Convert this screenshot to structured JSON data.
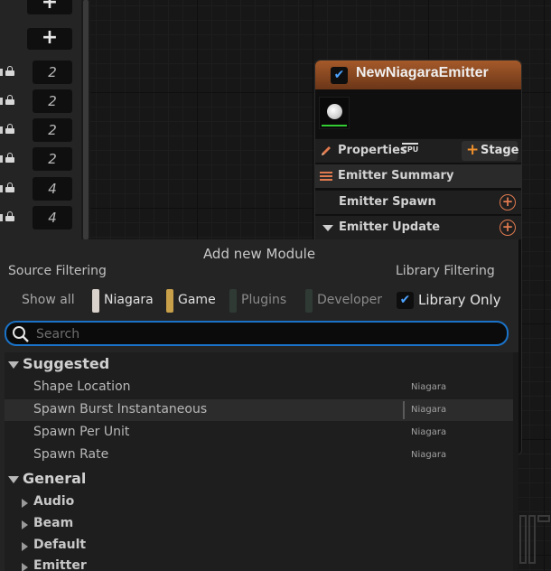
{
  "left_panel": {
    "add_buttons": [
      "+",
      "+"
    ],
    "rows": [
      {
        "value": "2"
      },
      {
        "value": "2"
      },
      {
        "value": "2"
      },
      {
        "value": "2"
      },
      {
        "value": "4"
      },
      {
        "value": "4"
      }
    ]
  },
  "node": {
    "title": "NewNiagaraEmitter",
    "enabled": true,
    "properties_label": "Properties",
    "cpu_badge": "CPU",
    "stage_plus": "+",
    "stage_label": "Stage",
    "rows": [
      {
        "label": "Emitter Summary"
      },
      {
        "label": "Emitter Spawn"
      },
      {
        "label": "Emitter Update"
      }
    ],
    "accent_color": "#e07a4f",
    "header_color": "#a55a2a"
  },
  "module_panel": {
    "title": "Add new Module",
    "source_filtering": "Source Filtering",
    "library_filtering": "Library Filtering",
    "show_all": "Show all",
    "chips": [
      {
        "label": "Niagara",
        "color": "#d9d2cc",
        "active": true
      },
      {
        "label": "Game",
        "color": "#c9a04a",
        "active": true
      },
      {
        "label": "Plugins",
        "color": "#2f3a35",
        "active": false
      },
      {
        "label": "Developer",
        "color": "#2f3a35",
        "active": false
      }
    ],
    "library_only_label": "Library Only",
    "library_only_checked": true,
    "search_placeholder": "Search",
    "search_value": "",
    "suggested_label": "Suggested",
    "suggested_items": [
      {
        "label": "Shape Location",
        "source": "Niagara"
      },
      {
        "label": "Spawn Burst Instantaneous",
        "source": "Niagara"
      },
      {
        "label": "Spawn Per Unit",
        "source": "Niagara"
      },
      {
        "label": "Spawn Rate",
        "source": "Niagara"
      }
    ],
    "general_label": "General",
    "general_categories": [
      {
        "label": "Audio"
      },
      {
        "label": "Beam"
      },
      {
        "label": "Default"
      },
      {
        "label": "Emitter"
      }
    ],
    "search_border_color": "#1a73c8"
  }
}
